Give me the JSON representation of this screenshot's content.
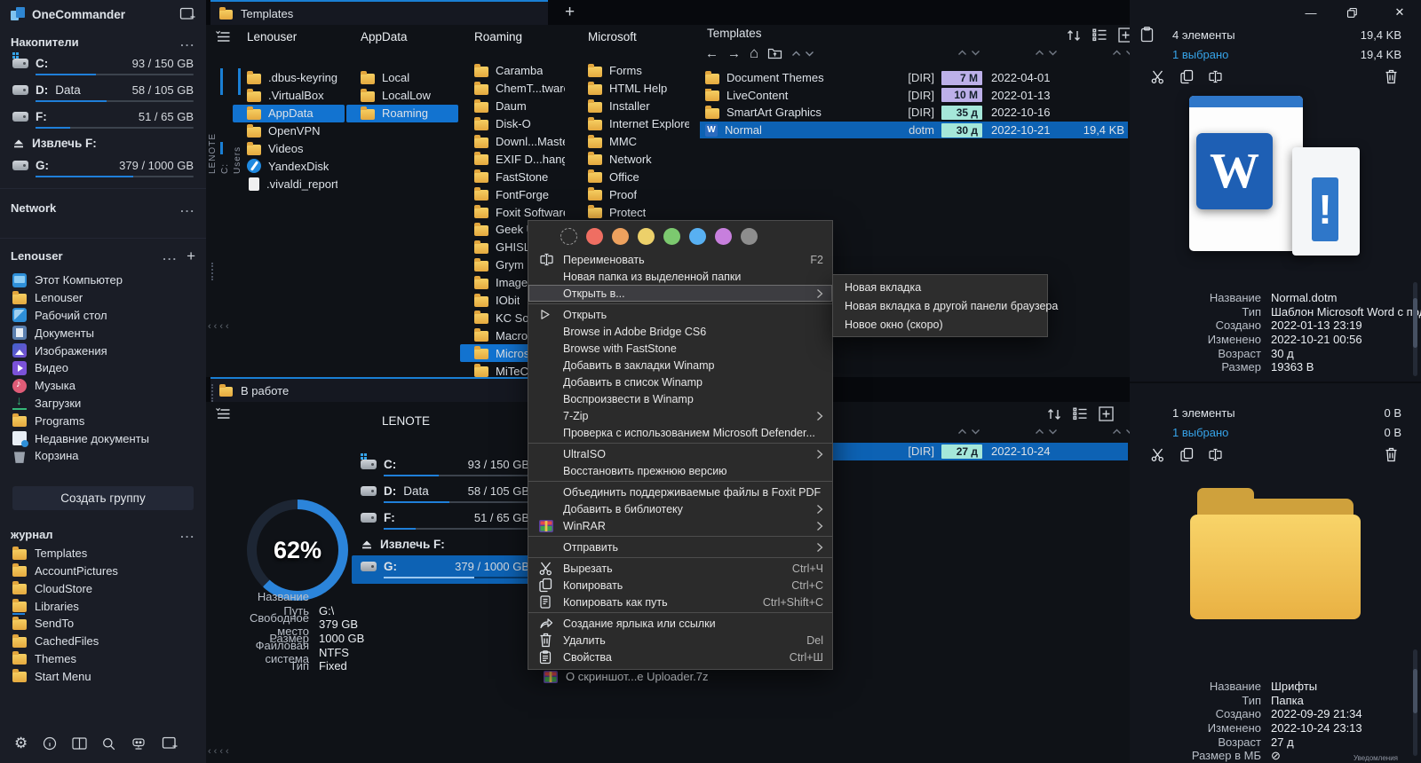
{
  "window": {
    "title": "OneCommander",
    "minimize": "—",
    "close": "✕"
  },
  "colors": {
    "accent": "#1a7fd4",
    "row_selection": "#0d62b4",
    "column_selection": "#1273d0",
    "badge_months_bg": "#bdb0e9",
    "badge_days_bg": "#a5e7d9",
    "selected_count_text": "#36a3e8",
    "folder_yellow": "#eebf53",
    "menu_bg": "#2b2b2b"
  },
  "icons": {
    "more": "...",
    "plus": "+",
    "back_arrow": "←",
    "forward_arrow": "→",
    "home": "⌂",
    "word_letter": "W",
    "exclamation": "!",
    "empty_size": "⊘",
    "chevrons_left": "‹‹‹‹"
  },
  "sidebar": {
    "drives_section": {
      "title": "Накопители",
      "drives": [
        {
          "letter": "C:",
          "name": "",
          "usage": "93 / 150 GB",
          "used_pct": 38,
          "system": true
        },
        {
          "letter": "D:",
          "name": "Data",
          "usage": "58 / 105 GB",
          "used_pct": 45,
          "system": false
        },
        {
          "letter": "F:",
          "name": "",
          "usage": "51 / 65 GB",
          "used_pct": 22,
          "system": false
        },
        {
          "letter": "G:",
          "name": "",
          "usage": "379 / 1000 GB",
          "used_pct": 62,
          "system": false
        }
      ],
      "eject_label": "Извлечь F:"
    },
    "network_section": {
      "title": "Network"
    },
    "user_section": {
      "title": "Lenouser",
      "items": [
        {
          "label": "Этот Компьютер",
          "icon": "computer"
        },
        {
          "label": "Lenouser",
          "icon": "folder"
        },
        {
          "label": "Рабочий стол",
          "icon": "desktop"
        },
        {
          "label": "Документы",
          "icon": "documents"
        },
        {
          "label": "Изображения",
          "icon": "pictures"
        },
        {
          "label": "Видео",
          "icon": "video"
        },
        {
          "label": "Музыка",
          "icon": "music"
        },
        {
          "label": "Загрузки",
          "icon": "downloads"
        },
        {
          "label": "Programs",
          "icon": "folder"
        },
        {
          "label": "Недавние документы",
          "icon": "recent"
        },
        {
          "label": "Корзина",
          "icon": "recycle"
        }
      ]
    },
    "create_group_label": "Создать группу",
    "journal_section": {
      "title": "журнал",
      "items": [
        {
          "label": "Templates",
          "accent": false
        },
        {
          "label": "AccountPictures",
          "accent": false
        },
        {
          "label": "CloudStore",
          "accent": false
        },
        {
          "label": "Libraries",
          "accent": true
        },
        {
          "label": "SendTo",
          "accent": false
        },
        {
          "label": "CachedFiles",
          "accent": false
        },
        {
          "label": "Themes",
          "accent": false
        },
        {
          "label": "Start Menu",
          "accent": false
        }
      ]
    }
  },
  "top_panel": {
    "tab_label": "Templates",
    "rail_labels": [
      "LENOTE",
      "C:",
      "Users"
    ],
    "columns": [
      {
        "title": "Lenouser",
        "items": [
          {
            "name": ".dbus-keyrings",
            "icon": "folder",
            "selected": false
          },
          {
            "name": ".VirtualBox",
            "icon": "folder",
            "selected": false
          },
          {
            "name": "AppData",
            "icon": "folder",
            "selected": true
          },
          {
            "name": "OpenVPN",
            "icon": "folder",
            "selected": false
          },
          {
            "name": "Videos",
            "icon": "folder",
            "selected": false
          },
          {
            "name": "YandexDisk",
            "icon": "yandex",
            "selected": false
          },
          {
            "name": ".vivaldi_reporti...",
            "icon": "file",
            "selected": false
          }
        ]
      },
      {
        "title": "AppData",
        "items": [
          {
            "name": "Local",
            "icon": "folder",
            "selected": false
          },
          {
            "name": "LocalLow",
            "icon": "folder",
            "selected": false
          },
          {
            "name": "Roaming",
            "icon": "folder",
            "selected": true
          }
        ]
      },
      {
        "title": "Roaming",
        "items": [
          {
            "name": "Caramba",
            "icon": "folder",
            "selected": false
          },
          {
            "name": "ChemT...tware",
            "icon": "folder",
            "selected": false
          },
          {
            "name": "Daum",
            "icon": "folder",
            "selected": false
          },
          {
            "name": "Disk-O",
            "icon": "folder",
            "selected": false
          },
          {
            "name": "Downl...Master",
            "icon": "folder",
            "selected": false
          },
          {
            "name": "EXIF D...hanger",
            "icon": "folder",
            "selected": false
          },
          {
            "name": "FastStone",
            "icon": "folder",
            "selected": false
          },
          {
            "name": "FontForge",
            "icon": "folder",
            "selected": false
          },
          {
            "name": "Foxit Software",
            "icon": "folder",
            "selected": false
          },
          {
            "name": "Geek U",
            "icon": "folder",
            "selected": false
          },
          {
            "name": "GHISLE",
            "icon": "folder",
            "selected": false
          },
          {
            "name": "Grym",
            "icon": "folder",
            "selected": false
          },
          {
            "name": "Image I",
            "icon": "folder",
            "selected": false
          },
          {
            "name": "IObit",
            "icon": "folder",
            "selected": false
          },
          {
            "name": "KC Soft",
            "icon": "folder",
            "selected": false
          },
          {
            "name": "Macror",
            "icon": "folder",
            "selected": false
          },
          {
            "name": "Micros",
            "icon": "folder",
            "selected": true
          },
          {
            "name": "MiTeC",
            "icon": "folder",
            "selected": false
          }
        ]
      },
      {
        "title": "Microsoft",
        "items": [
          {
            "name": "Forms",
            "icon": "folder",
            "selected": false
          },
          {
            "name": "HTML Help",
            "icon": "folder",
            "selected": false
          },
          {
            "name": "Installer",
            "icon": "folder",
            "selected": false
          },
          {
            "name": "Internet Explorer",
            "icon": "folder",
            "selected": false
          },
          {
            "name": "MMC",
            "icon": "folder",
            "selected": false
          },
          {
            "name": "Network",
            "icon": "folder",
            "selected": false
          },
          {
            "name": "Office",
            "icon": "folder",
            "selected": false
          },
          {
            "name": "Proof",
            "icon": "folder",
            "selected": false
          },
          {
            "name": "Protect",
            "icon": "folder",
            "selected": false
          }
        ]
      }
    ],
    "file_list": {
      "title": "Templates",
      "rows": [
        {
          "name": "Document Themes",
          "icon": "folder",
          "type": "[DIR]",
          "age": "7 М",
          "age_kind": "months",
          "date": "2022-04-01",
          "size": "",
          "selected": false
        },
        {
          "name": "LiveContent",
          "icon": "folder",
          "type": "[DIR]",
          "age": "10 М",
          "age_kind": "months",
          "date": "2022-01-13",
          "size": "",
          "selected": false
        },
        {
          "name": "SmartArt Graphics",
          "icon": "folder",
          "type": "[DIR]",
          "age": "35 д",
          "age_kind": "days",
          "date": "2022-10-16",
          "size": "",
          "selected": false
        },
        {
          "name": "Normal",
          "icon": "word",
          "type": "dotm",
          "age": "30 д",
          "age_kind": "days",
          "date": "2022-10-21",
          "size": "19,4 KB",
          "selected": true
        }
      ]
    }
  },
  "right_top": {
    "count": "4 элементы",
    "total_size": "19,4 KB",
    "selected_count": "1 выбрано",
    "selected_size": "19,4 KB",
    "details": [
      [
        "Название",
        "Normal.dotm"
      ],
      [
        "Тип",
        "Шаблон Microsoft Word с поддер"
      ],
      [
        "Создано",
        "2022-01-13  23:19"
      ],
      [
        "Изменено",
        "2022-10-21  00:56"
      ],
      [
        "Возраст",
        "30 д"
      ],
      [
        "Размер",
        "19363 B"
      ]
    ]
  },
  "right_bottom": {
    "count": "1 элементы",
    "total_size": "0 B",
    "selected_count": "1 выбрано",
    "selected_size": "0 B",
    "details": [
      [
        "Название",
        "Шрифты"
      ],
      [
        "Тип",
        "Папка"
      ],
      [
        "Создано",
        "2022-09-29  21:34"
      ],
      [
        "Изменено",
        "2022-10-24  23:13"
      ],
      [
        "Возраст",
        "27 д"
      ],
      [
        "Размер в МБ",
        "⊘"
      ]
    ],
    "notifications_label": "Уведомления"
  },
  "bottom_panel": {
    "tab_label": "В работе",
    "column_title": "LENOTE",
    "donut_pct": "62%",
    "drives": [
      {
        "letter": "C:",
        "name": "",
        "usage": "93 / 150 GB",
        "used_pct": 38,
        "system": true,
        "selected": false
      },
      {
        "letter": "D:",
        "name": "Data",
        "usage": "58 / 105 GB",
        "used_pct": 45,
        "system": false,
        "selected": false
      },
      {
        "letter": "F:",
        "name": "",
        "usage": "51 / 65 GB",
        "used_pct": 22,
        "system": false,
        "selected": false
      },
      {
        "letter": "G:",
        "name": "",
        "usage": "379 / 1000 GB",
        "used_pct": 62,
        "system": false,
        "selected": true
      }
    ],
    "eject_label": "Извлечь F:",
    "drive_details": [
      [
        "Название",
        ""
      ],
      [
        "Путь",
        "G:\\"
      ],
      [
        "Свободное место",
        "379 GB"
      ],
      [
        "Размер",
        "1000 GB"
      ],
      [
        "Файловая система",
        "NTFS"
      ],
      [
        "Тип",
        "Fixed"
      ]
    ],
    "selected_row": {
      "name": "",
      "icon": null,
      "type": "[DIR]",
      "age": "27 д",
      "age_kind": "days",
      "date": "2022-10-24",
      "size": "",
      "selected": true
    },
    "archive_item": "О скриншот...е Uploader.7z"
  },
  "context_menu": {
    "swatches": [
      "none",
      "#ef6e62",
      "#eda15e",
      "#ecd06a",
      "#7cc96f",
      "#58b0f2",
      "#c77fdd",
      "#8d8d8d"
    ],
    "items": [
      {
        "label": "Переименовать",
        "icon": "rename",
        "shortcut": "F2",
        "submenu": false,
        "highlighted": false,
        "sep_after": false
      },
      {
        "label": "Новая папка из выделенной папки",
        "icon": null,
        "shortcut": "",
        "submenu": false,
        "highlighted": false,
        "sep_after": false
      },
      {
        "label": "Открыть в...",
        "icon": null,
        "shortcut": "",
        "submenu": true,
        "highlighted": true,
        "sep_after": true
      },
      {
        "label": "Открыть",
        "icon": "play",
        "shortcut": "",
        "submenu": false,
        "highlighted": false,
        "sep_after": false
      },
      {
        "label": "Browse in Adobe Bridge CS6",
        "icon": null,
        "shortcut": "",
        "submenu": false,
        "highlighted": false,
        "sep_after": false
      },
      {
        "label": "Browse with FastStone",
        "icon": null,
        "shortcut": "",
        "submenu": false,
        "highlighted": false,
        "sep_after": false
      },
      {
        "label": "Добавить в закладки Winamp",
        "icon": null,
        "shortcut": "",
        "submenu": false,
        "highlighted": false,
        "sep_after": false
      },
      {
        "label": "Добавить в список Winamp",
        "icon": null,
        "shortcut": "",
        "submenu": false,
        "highlighted": false,
        "sep_after": false
      },
      {
        "label": "Воспроизвести в Winamp",
        "icon": null,
        "shortcut": "",
        "submenu": false,
        "highlighted": false,
        "sep_after": false
      },
      {
        "label": "7-Zip",
        "icon": null,
        "shortcut": "",
        "submenu": true,
        "highlighted": false,
        "sep_after": false
      },
      {
        "label": "Проверка с использованием Microsoft Defender...",
        "icon": null,
        "shortcut": "",
        "submenu": false,
        "highlighted": false,
        "sep_after": true
      },
      {
        "label": "UltraISO",
        "icon": null,
        "shortcut": "",
        "submenu": true,
        "highlighted": false,
        "sep_after": false
      },
      {
        "label": "Восстановить прежнюю версию",
        "icon": null,
        "shortcut": "",
        "submenu": false,
        "highlighted": false,
        "sep_after": true
      },
      {
        "label": "Объединить поддерживаемые файлы в Foxit PDF Editor...",
        "icon": null,
        "shortcut": "",
        "submenu": false,
        "highlighted": false,
        "sep_after": false
      },
      {
        "label": "Добавить в библиотеку",
        "icon": null,
        "shortcut": "",
        "submenu": true,
        "highlighted": false,
        "sep_after": false
      },
      {
        "label": "WinRAR",
        "icon": "winrar",
        "shortcut": "",
        "submenu": true,
        "highlighted": false,
        "sep_after": true
      },
      {
        "label": "Отправить",
        "icon": null,
        "shortcut": "",
        "submenu": true,
        "highlighted": false,
        "sep_after": true
      },
      {
        "label": "Вырезать",
        "icon": "cut",
        "shortcut": "Ctrl+Ч",
        "submenu": false,
        "highlighted": false,
        "sep_after": false
      },
      {
        "label": "Копировать",
        "icon": "copy",
        "shortcut": "Ctrl+C",
        "submenu": false,
        "highlighted": false,
        "sep_after": false
      },
      {
        "label": "Копировать как путь",
        "icon": "copypath",
        "shortcut": "Ctrl+Shift+C",
        "submenu": false,
        "highlighted": false,
        "sep_after": true
      },
      {
        "label": "Создание ярлыка или ссылки",
        "icon": "shortcut",
        "shortcut": "",
        "submenu": false,
        "highlighted": false,
        "sep_after": false
      },
      {
        "label": "Удалить",
        "icon": "trash",
        "shortcut": "Del",
        "submenu": false,
        "highlighted": false,
        "sep_after": false
      },
      {
        "label": "Свойства",
        "icon": "props",
        "shortcut": "Ctrl+Ш",
        "submenu": false,
        "highlighted": false,
        "sep_after": false
      }
    ]
  },
  "submenu": {
    "items": [
      "Новая вкладка",
      "Новая вкладка в другой панели браузера",
      "Новое окно (скоро)"
    ]
  }
}
